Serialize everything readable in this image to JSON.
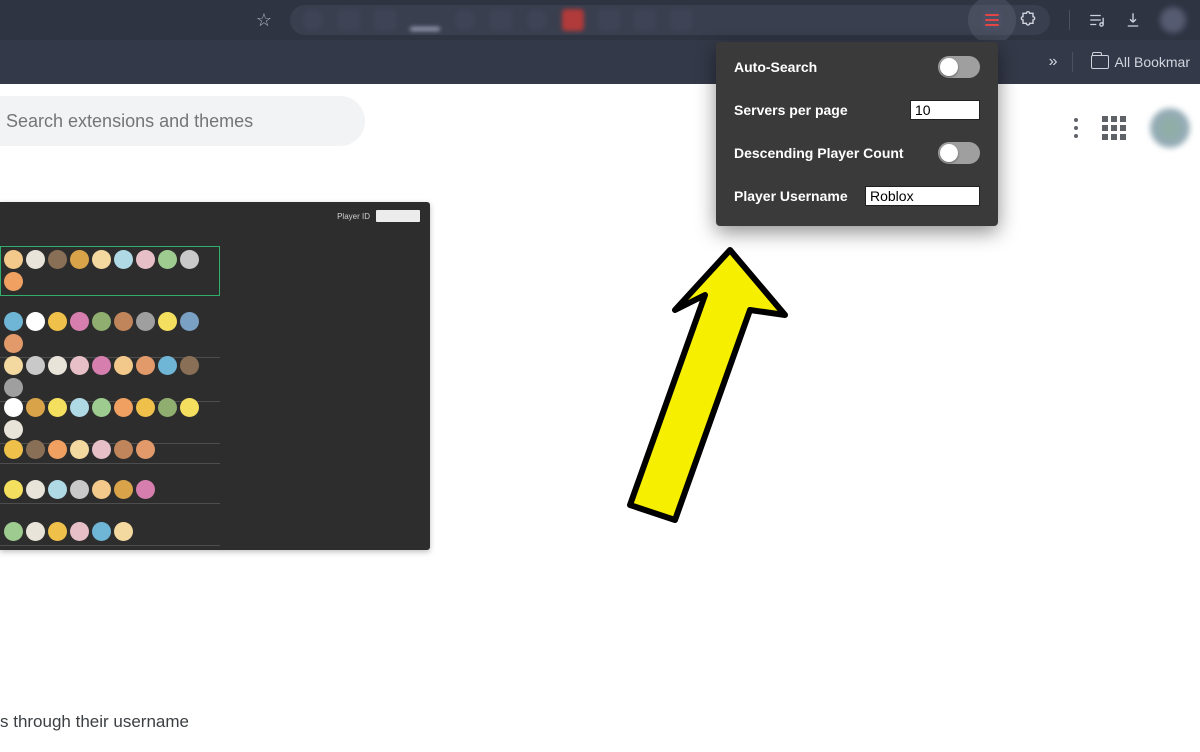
{
  "bookmarks": {
    "all": "All Bookmar"
  },
  "search": {
    "placeholder": "Search extensions and themes"
  },
  "thumb": {
    "playerIdLabel": "Player ID"
  },
  "popup": {
    "autoSearch": {
      "label": "Auto-Search",
      "on": false
    },
    "serversPerPage": {
      "label": "Servers per page",
      "value": "10"
    },
    "descending": {
      "label": "Descending Player Count",
      "on": false
    },
    "username": {
      "label": "Player Username",
      "value": "Roblox"
    }
  },
  "page": {
    "caption": "s through their username"
  }
}
